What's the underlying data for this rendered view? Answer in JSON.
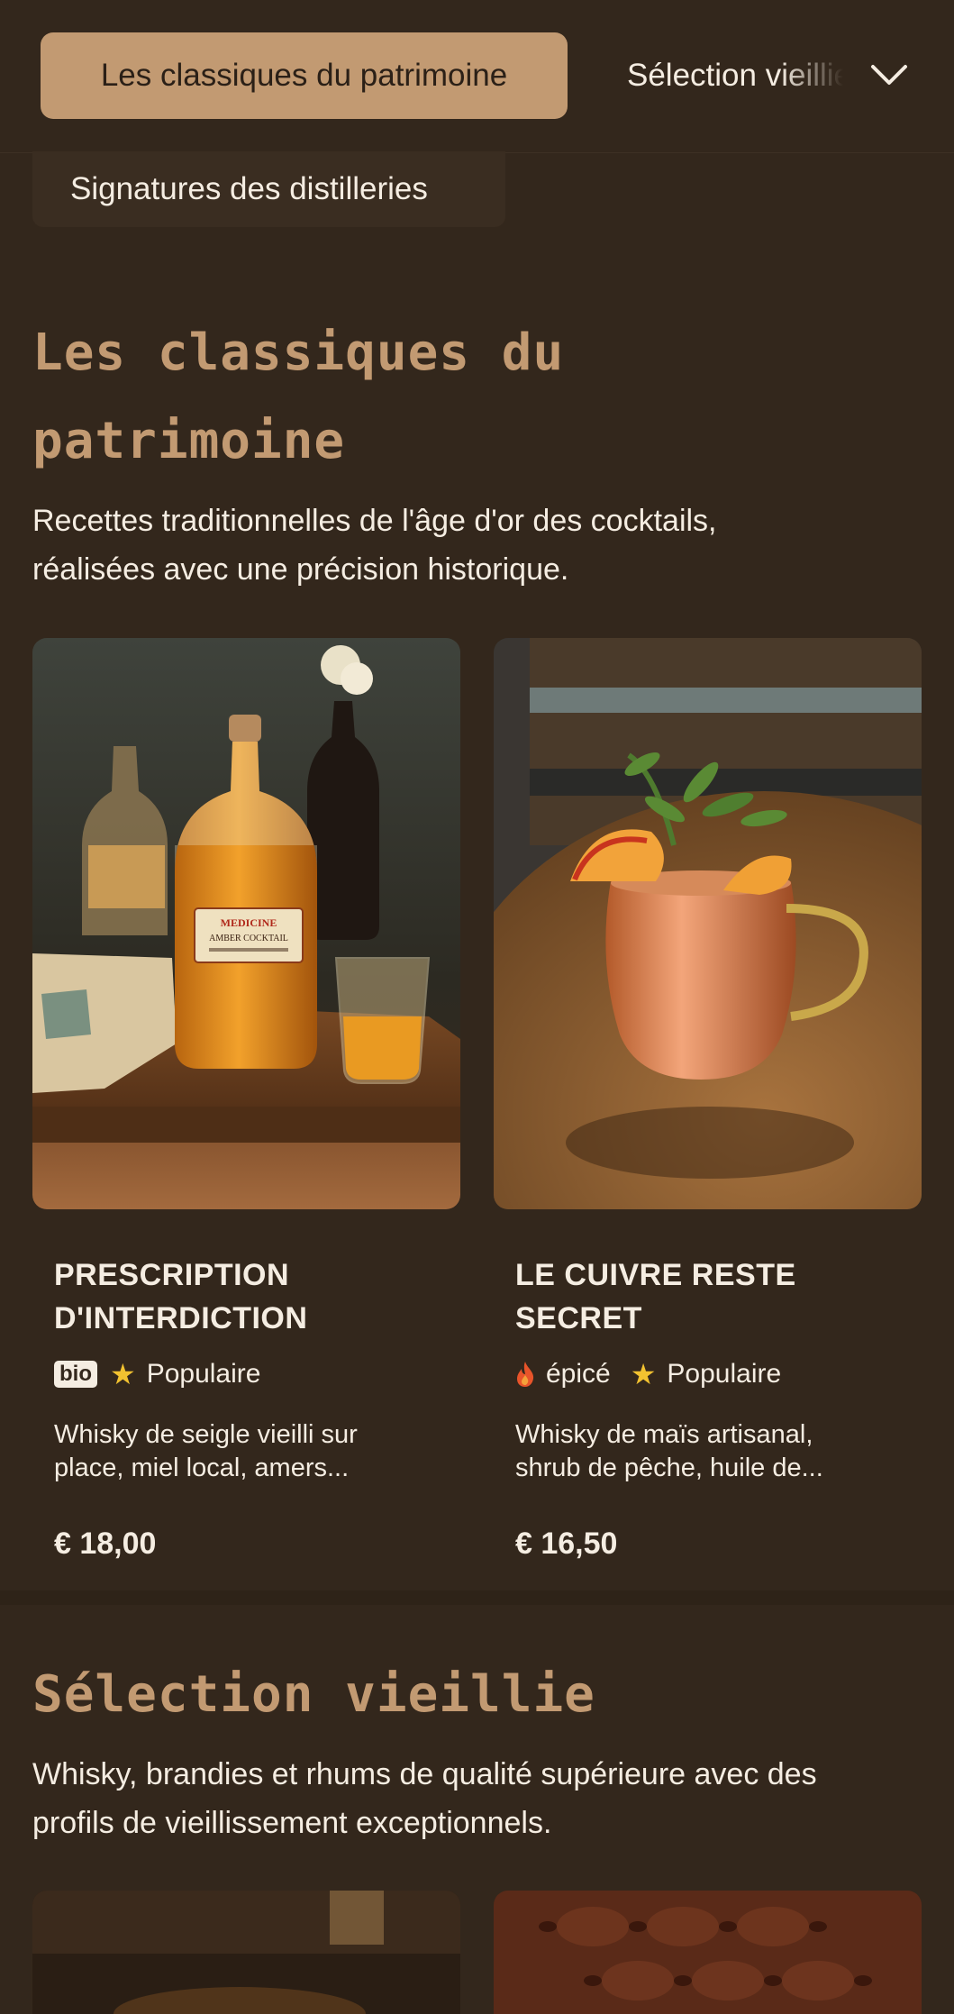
{
  "tabs": {
    "active": "Les classiques du patrimoine",
    "next": "Sélection vieillie",
    "second_row": "Signatures des distilleries"
  },
  "sections": [
    {
      "title": "Les classiques du patrimoine",
      "title_line1": "Les classiques du",
      "title_line2": "patrimoine",
      "description": "Recettes traditionnelles de l'âge d'or des cocktails, réalisées avec une précision historique.",
      "description_line1": "Recettes traditionnelles de l'âge d'or des cocktails,",
      "description_line2": "réalisées avec une précision historique.",
      "items": [
        {
          "name_line1": "PRESCRIPTION",
          "name_line2": "D'INTERDICTION",
          "badge": "bio",
          "tag": "Populaire",
          "desc_line1": "Whisky de seigle vieilli sur",
          "desc_line2": "place, miel local, amers...",
          "price": "€ 18,00",
          "image_label_1": "MEDICINE",
          "image_label_2": "AMBER COCKTAIL"
        },
        {
          "name_line1": "LE CUIVRE RESTE",
          "name_line2": "SECRET",
          "spice": "épicé",
          "tag": "Populaire",
          "desc_line1": "Whisky de maïs artisanal,",
          "desc_line2": "shrub de pêche, huile de...",
          "price": "€ 16,50"
        }
      ]
    },
    {
      "title": "Sélection vieillie",
      "description_line1": "Whisky, brandies et rhums de qualité supérieure avec des",
      "description_line2": "profils de vieillissement exceptionnels."
    }
  ],
  "icons": {
    "chevron": "chevron-down-icon",
    "star": "star-icon",
    "flame": "flame-icon"
  },
  "colors": {
    "background": "#33271c",
    "accent": "#c29a72",
    "text": "#f5ede2",
    "star": "#f2c230",
    "flame": "#e8542a"
  }
}
